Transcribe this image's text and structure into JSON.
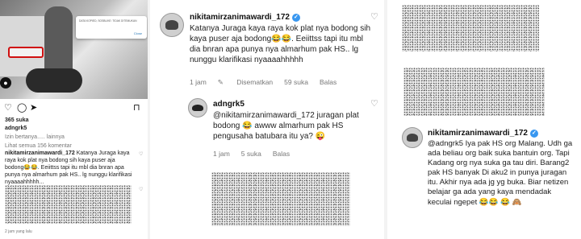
{
  "left": {
    "dialog_message": "DATA KOPIED, SOSBLIKE: TIDAK DITEMUKAN",
    "dialog_button": "Close",
    "likes": "365 suka",
    "author": "adngrk5",
    "caption_preview": "Izin bertanya.....",
    "caption_more": "lainnya",
    "view_comments": "Lihat semua 156 komentar",
    "comment_user": "nikitamirzanimawardi_172",
    "comment_text": "Katanya Juraga kaya raya kok plat nya bodong sih kaya puser aja bodong😂😂. Eeiittss tapi itu mbl dia bnran apa punya nya almarhum pak HS.. lg nunggu klarifikasi nyaaaahhhhh...",
    "footer": "2 jam yang lalu",
    "icons": {
      "like": "heart-icon",
      "comment": "comment-icon",
      "share": "share-icon",
      "save": "bookmark-icon"
    }
  },
  "middle": {
    "comment1": {
      "user": "nikitamirzanimawardi_172",
      "text": "Katanya Juraga kaya raya kok plat nya bodong sih kaya puser aja bodong😂😂. Eeiittss tapi itu mbl dia bnran apa punya nya almarhum pak HS.. lg nunggu klarifikasi nyaaaahhhhh",
      "time": "1 jam",
      "pinned": "Disematkan",
      "likes": "59 suka",
      "reply": "Balas"
    },
    "comment2": {
      "user": "adngrk5",
      "text": "@nikitamirzanimawardi_172 juragan plat bodong 😂 awww almarhum pak HS pengusaha batubara itu ya? 😜",
      "time": "1 jam",
      "likes": "5 suka",
      "reply": "Balas"
    }
  },
  "right": {
    "reply": {
      "user": "nikitamirzanimawardi_172",
      "text": "@adngrk5 Iya pak HS org Malang. Udh ga ada beliau org baik suka bantuin org. Tapi Kadang org nya suka ga tau diri. Barang2 pak HS banyak Di aku2 in punya juragan itu. Akhir nya ada jg yg buka. Biar netizen belajar ga ada yang kaya mendadak keculai ngepet 😂😂 😂 🙈"
    }
  }
}
